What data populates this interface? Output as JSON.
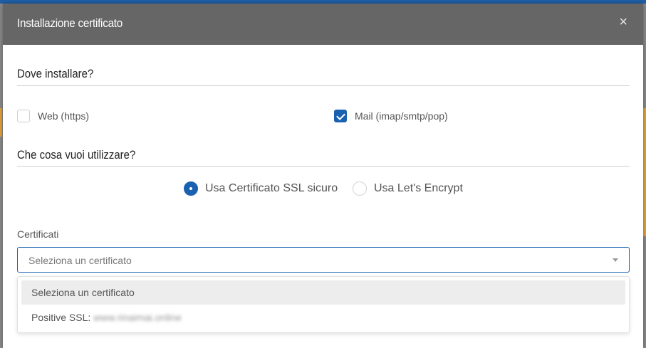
{
  "dialog": {
    "title": "Installazione certificato",
    "close_glyph": "×"
  },
  "where_section": {
    "title": "Dove installare?",
    "options": [
      {
        "label": "Web (https)",
        "checked": false
      },
      {
        "label": "Mail (imap/smtp/pop)",
        "checked": true
      }
    ]
  },
  "what_section": {
    "title": "Che cosa vuoi utilizzare?",
    "options": [
      {
        "label": "Usa Certificato SSL sicuro",
        "selected": true
      },
      {
        "label": "Usa Let's Encrypt",
        "selected": false
      }
    ]
  },
  "certificates": {
    "label": "Certificati",
    "placeholder": "Seleziona un certificato",
    "options": [
      {
        "label": "Seleziona un certificato"
      },
      {
        "label": "Positive SSL:",
        "redacted": "www.rinaimai.online"
      }
    ]
  },
  "colors": {
    "header_bg": "#666666",
    "accent": "#1a62b0"
  }
}
